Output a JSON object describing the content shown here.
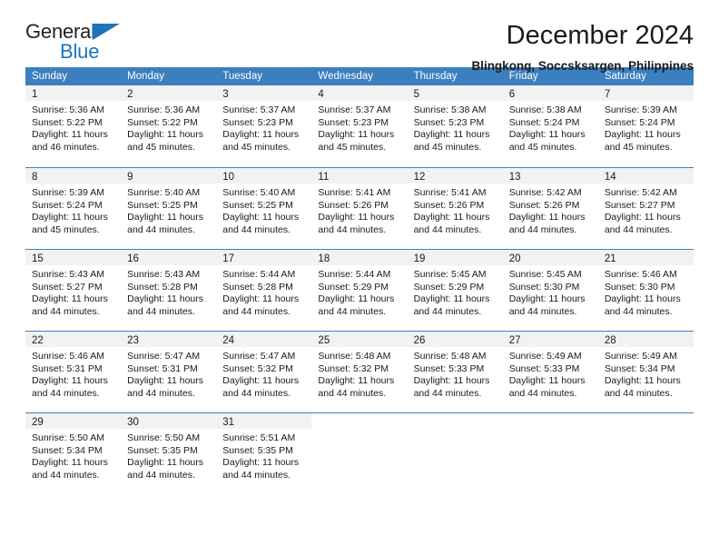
{
  "brand": {
    "name_top": "General",
    "name_bottom": "Blue",
    "accent_color": "#1c75bc",
    "triangle_icon": "triangle-icon"
  },
  "header": {
    "title": "December 2024",
    "subtitle": "Blingkong, Soccsksargen, Philippines"
  },
  "theme": {
    "header_row_bg": "#3c7fbf",
    "daynum_band_bg": "#f2f2f2",
    "week_divider": "#3c7fbf",
    "text": "#1a1a1a"
  },
  "weekdays": [
    "Sunday",
    "Monday",
    "Tuesday",
    "Wednesday",
    "Thursday",
    "Friday",
    "Saturday"
  ],
  "weeks": [
    [
      {
        "day": "1",
        "sunrise": "Sunrise: 5:36 AM",
        "sunset": "Sunset: 5:22 PM",
        "daylight_1": "Daylight: 11 hours",
        "daylight_2": "and 46 minutes."
      },
      {
        "day": "2",
        "sunrise": "Sunrise: 5:36 AM",
        "sunset": "Sunset: 5:22 PM",
        "daylight_1": "Daylight: 11 hours",
        "daylight_2": "and 45 minutes."
      },
      {
        "day": "3",
        "sunrise": "Sunrise: 5:37 AM",
        "sunset": "Sunset: 5:23 PM",
        "daylight_1": "Daylight: 11 hours",
        "daylight_2": "and 45 minutes."
      },
      {
        "day": "4",
        "sunrise": "Sunrise: 5:37 AM",
        "sunset": "Sunset: 5:23 PM",
        "daylight_1": "Daylight: 11 hours",
        "daylight_2": "and 45 minutes."
      },
      {
        "day": "5",
        "sunrise": "Sunrise: 5:38 AM",
        "sunset": "Sunset: 5:23 PM",
        "daylight_1": "Daylight: 11 hours",
        "daylight_2": "and 45 minutes."
      },
      {
        "day": "6",
        "sunrise": "Sunrise: 5:38 AM",
        "sunset": "Sunset: 5:24 PM",
        "daylight_1": "Daylight: 11 hours",
        "daylight_2": "and 45 minutes."
      },
      {
        "day": "7",
        "sunrise": "Sunrise: 5:39 AM",
        "sunset": "Sunset: 5:24 PM",
        "daylight_1": "Daylight: 11 hours",
        "daylight_2": "and 45 minutes."
      }
    ],
    [
      {
        "day": "8",
        "sunrise": "Sunrise: 5:39 AM",
        "sunset": "Sunset: 5:24 PM",
        "daylight_1": "Daylight: 11 hours",
        "daylight_2": "and 45 minutes."
      },
      {
        "day": "9",
        "sunrise": "Sunrise: 5:40 AM",
        "sunset": "Sunset: 5:25 PM",
        "daylight_1": "Daylight: 11 hours",
        "daylight_2": "and 44 minutes."
      },
      {
        "day": "10",
        "sunrise": "Sunrise: 5:40 AM",
        "sunset": "Sunset: 5:25 PM",
        "daylight_1": "Daylight: 11 hours",
        "daylight_2": "and 44 minutes."
      },
      {
        "day": "11",
        "sunrise": "Sunrise: 5:41 AM",
        "sunset": "Sunset: 5:26 PM",
        "daylight_1": "Daylight: 11 hours",
        "daylight_2": "and 44 minutes."
      },
      {
        "day": "12",
        "sunrise": "Sunrise: 5:41 AM",
        "sunset": "Sunset: 5:26 PM",
        "daylight_1": "Daylight: 11 hours",
        "daylight_2": "and 44 minutes."
      },
      {
        "day": "13",
        "sunrise": "Sunrise: 5:42 AM",
        "sunset": "Sunset: 5:26 PM",
        "daylight_1": "Daylight: 11 hours",
        "daylight_2": "and 44 minutes."
      },
      {
        "day": "14",
        "sunrise": "Sunrise: 5:42 AM",
        "sunset": "Sunset: 5:27 PM",
        "daylight_1": "Daylight: 11 hours",
        "daylight_2": "and 44 minutes."
      }
    ],
    [
      {
        "day": "15",
        "sunrise": "Sunrise: 5:43 AM",
        "sunset": "Sunset: 5:27 PM",
        "daylight_1": "Daylight: 11 hours",
        "daylight_2": "and 44 minutes."
      },
      {
        "day": "16",
        "sunrise": "Sunrise: 5:43 AM",
        "sunset": "Sunset: 5:28 PM",
        "daylight_1": "Daylight: 11 hours",
        "daylight_2": "and 44 minutes."
      },
      {
        "day": "17",
        "sunrise": "Sunrise: 5:44 AM",
        "sunset": "Sunset: 5:28 PM",
        "daylight_1": "Daylight: 11 hours",
        "daylight_2": "and 44 minutes."
      },
      {
        "day": "18",
        "sunrise": "Sunrise: 5:44 AM",
        "sunset": "Sunset: 5:29 PM",
        "daylight_1": "Daylight: 11 hours",
        "daylight_2": "and 44 minutes."
      },
      {
        "day": "19",
        "sunrise": "Sunrise: 5:45 AM",
        "sunset": "Sunset: 5:29 PM",
        "daylight_1": "Daylight: 11 hours",
        "daylight_2": "and 44 minutes."
      },
      {
        "day": "20",
        "sunrise": "Sunrise: 5:45 AM",
        "sunset": "Sunset: 5:30 PM",
        "daylight_1": "Daylight: 11 hours",
        "daylight_2": "and 44 minutes."
      },
      {
        "day": "21",
        "sunrise": "Sunrise: 5:46 AM",
        "sunset": "Sunset: 5:30 PM",
        "daylight_1": "Daylight: 11 hours",
        "daylight_2": "and 44 minutes."
      }
    ],
    [
      {
        "day": "22",
        "sunrise": "Sunrise: 5:46 AM",
        "sunset": "Sunset: 5:31 PM",
        "daylight_1": "Daylight: 11 hours",
        "daylight_2": "and 44 minutes."
      },
      {
        "day": "23",
        "sunrise": "Sunrise: 5:47 AM",
        "sunset": "Sunset: 5:31 PM",
        "daylight_1": "Daylight: 11 hours",
        "daylight_2": "and 44 minutes."
      },
      {
        "day": "24",
        "sunrise": "Sunrise: 5:47 AM",
        "sunset": "Sunset: 5:32 PM",
        "daylight_1": "Daylight: 11 hours",
        "daylight_2": "and 44 minutes."
      },
      {
        "day": "25",
        "sunrise": "Sunrise: 5:48 AM",
        "sunset": "Sunset: 5:32 PM",
        "daylight_1": "Daylight: 11 hours",
        "daylight_2": "and 44 minutes."
      },
      {
        "day": "26",
        "sunrise": "Sunrise: 5:48 AM",
        "sunset": "Sunset: 5:33 PM",
        "daylight_1": "Daylight: 11 hours",
        "daylight_2": "and 44 minutes."
      },
      {
        "day": "27",
        "sunrise": "Sunrise: 5:49 AM",
        "sunset": "Sunset: 5:33 PM",
        "daylight_1": "Daylight: 11 hours",
        "daylight_2": "and 44 minutes."
      },
      {
        "day": "28",
        "sunrise": "Sunrise: 5:49 AM",
        "sunset": "Sunset: 5:34 PM",
        "daylight_1": "Daylight: 11 hours",
        "daylight_2": "and 44 minutes."
      }
    ],
    [
      {
        "day": "29",
        "sunrise": "Sunrise: 5:50 AM",
        "sunset": "Sunset: 5:34 PM",
        "daylight_1": "Daylight: 11 hours",
        "daylight_2": "and 44 minutes."
      },
      {
        "day": "30",
        "sunrise": "Sunrise: 5:50 AM",
        "sunset": "Sunset: 5:35 PM",
        "daylight_1": "Daylight: 11 hours",
        "daylight_2": "and 44 minutes."
      },
      {
        "day": "31",
        "sunrise": "Sunrise: 5:51 AM",
        "sunset": "Sunset: 5:35 PM",
        "daylight_1": "Daylight: 11 hours",
        "daylight_2": "and 44 minutes."
      },
      {
        "day": "",
        "sunrise": "",
        "sunset": "",
        "daylight_1": "",
        "daylight_2": ""
      },
      {
        "day": "",
        "sunrise": "",
        "sunset": "",
        "daylight_1": "",
        "daylight_2": ""
      },
      {
        "day": "",
        "sunrise": "",
        "sunset": "",
        "daylight_1": "",
        "daylight_2": ""
      },
      {
        "day": "",
        "sunrise": "",
        "sunset": "",
        "daylight_1": "",
        "daylight_2": ""
      }
    ]
  ]
}
